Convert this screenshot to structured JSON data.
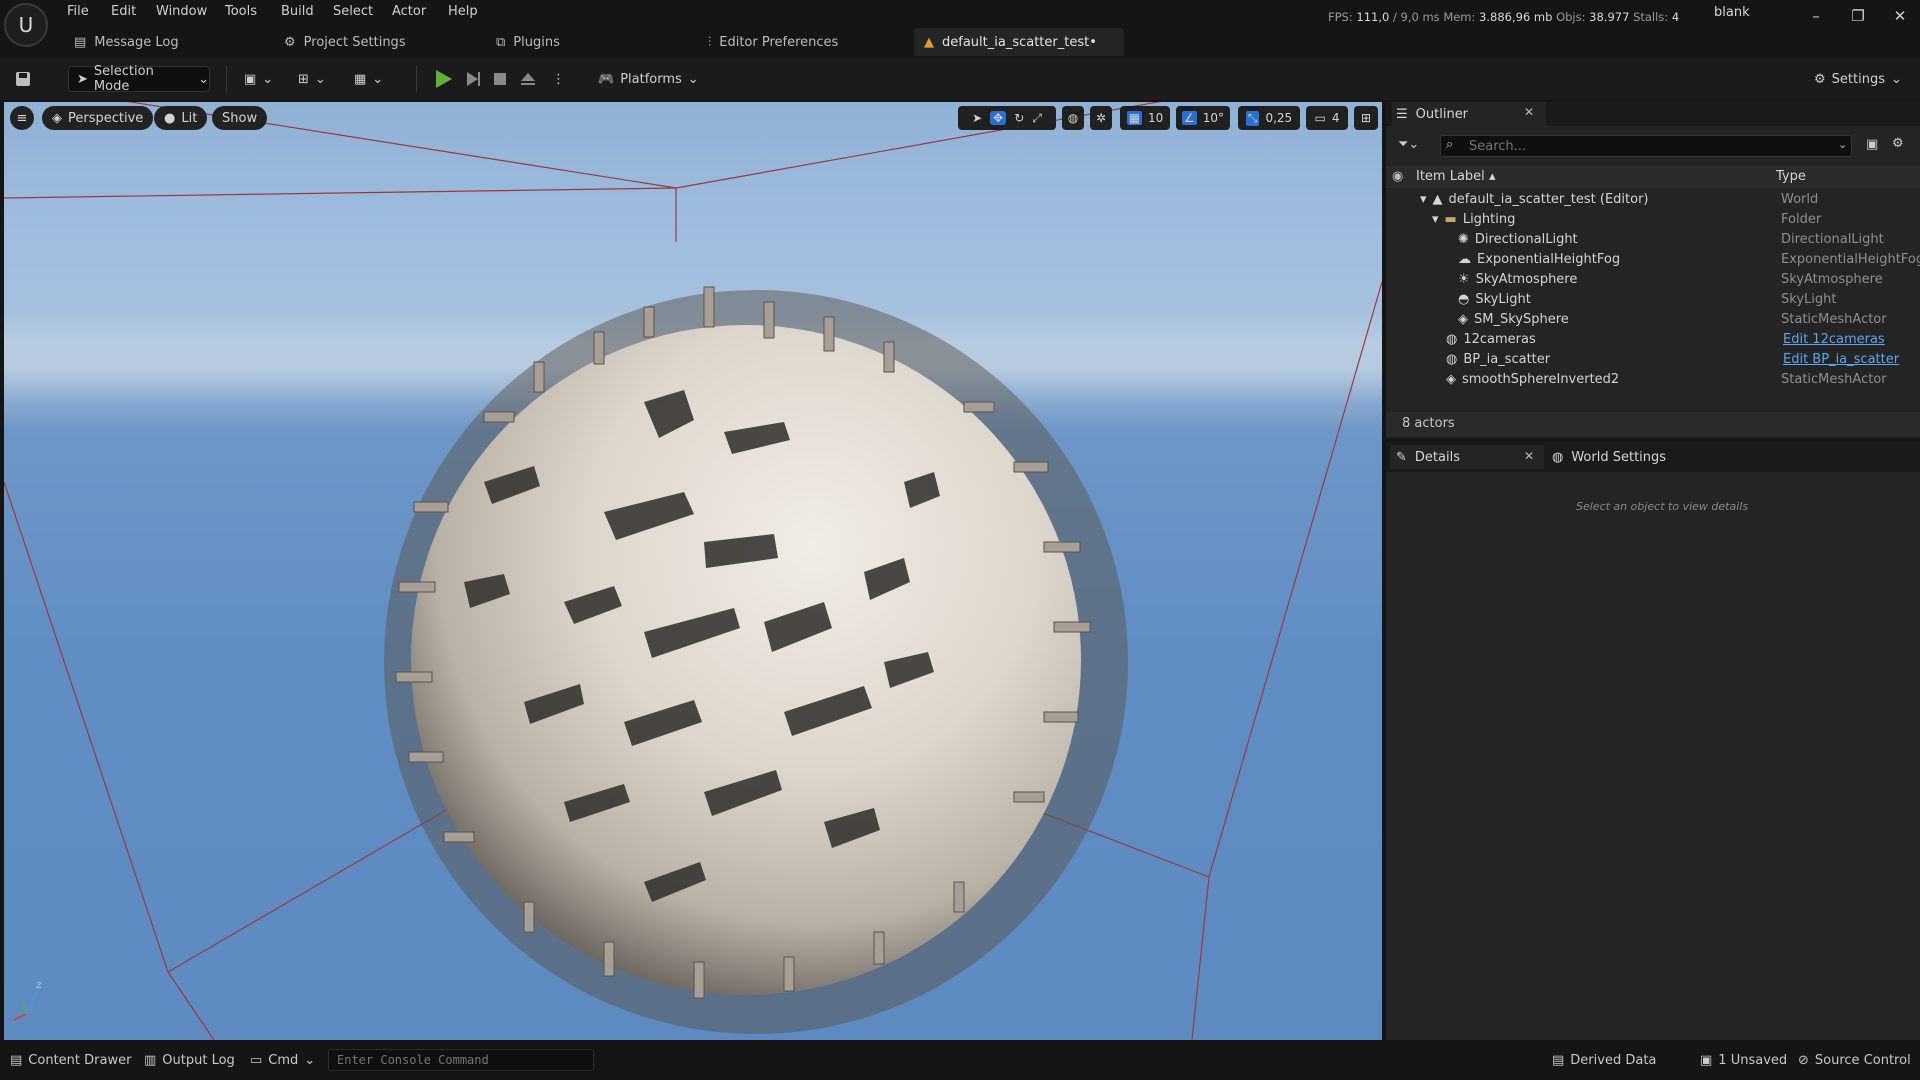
{
  "menu": [
    "File",
    "Edit",
    "Window",
    "Tools",
    "Build",
    "Select",
    "Actor",
    "Help"
  ],
  "stats": {
    "fps_label": "FPS:",
    "fps": "111,0",
    "ms": "/ 9,0 ms",
    "mem_label": "Mem:",
    "mem": "3.886,96 mb",
    "objs_label": "Objs:",
    "objs": "38.977",
    "stalls_label": "Stalls:",
    "stalls": "4"
  },
  "project_name": "blank",
  "tabs": {
    "message_log": "Message Log",
    "project_settings": "Project Settings",
    "plugins": "Plugins",
    "editor_preferences": "Editor Preferences",
    "level": "default_ia_scatter_test•"
  },
  "toolbar": {
    "selection_mode": "Selection Mode",
    "platforms": "Platforms",
    "settings": "Settings"
  },
  "viewport": {
    "perspective": "Perspective",
    "lit": "Lit",
    "show": "Show",
    "grid_snap": "10",
    "rotate_snap": "10°",
    "scale_snap": "0,25",
    "camera_speed": "4"
  },
  "outliner": {
    "title": "Outliner",
    "search_placeholder": "Search...",
    "col_label": "Item Label",
    "col_type": "Type",
    "rows": [
      {
        "label": "default_ia_scatter_test (Editor)",
        "type": "World",
        "link": false
      },
      {
        "label": "Lighting",
        "type": "Folder",
        "link": false
      },
      {
        "label": "DirectionalLight",
        "type": "DirectionalLight",
        "link": false
      },
      {
        "label": "ExponentialHeightFog",
        "type": "ExponentialHeightFog",
        "link": false
      },
      {
        "label": "SkyAtmosphere",
        "type": "SkyAtmosphere",
        "link": false
      },
      {
        "label": "SkyLight",
        "type": "SkyLight",
        "link": false
      },
      {
        "label": "SM_SkySphere",
        "type": "StaticMeshActor",
        "link": false
      },
      {
        "label": "12cameras",
        "type": "Edit 12cameras",
        "link": true
      },
      {
        "label": "BP_ia_scatter",
        "type": "Edit BP_ia_scatter",
        "link": true
      },
      {
        "label": "smoothSphereInverted2",
        "type": "StaticMeshActor",
        "link": false
      }
    ],
    "actors_count": "8 actors"
  },
  "details": {
    "tab_details": "Details",
    "tab_world_settings": "World Settings",
    "empty_message": "Select an object to view details"
  },
  "statusbar": {
    "content_drawer": "Content Drawer",
    "output_log": "Output Log",
    "cmd": "Cmd",
    "console_placeholder": "Enter Console Command",
    "derived_data": "Derived Data",
    "unsaved": "1 Unsaved",
    "source_control": "Source Control"
  },
  "colors": {
    "link": "#5ea5ee",
    "play_green": "#5fb336",
    "panel_bg": "#242424",
    "sky_blue": "#5f8dc4"
  }
}
